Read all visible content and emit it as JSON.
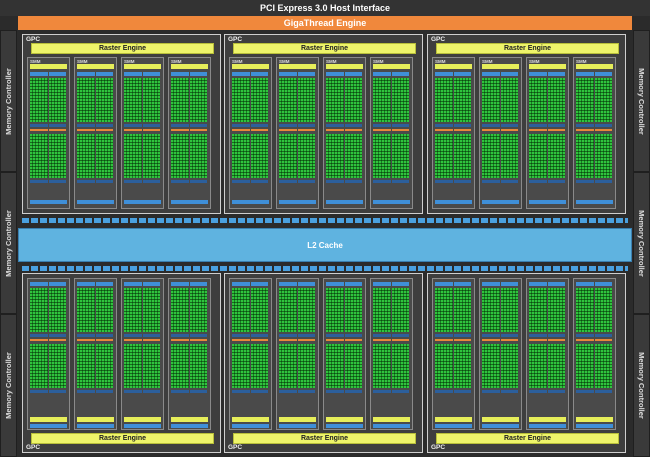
{
  "host_interface": "PCI Express 3.0 Host Interface",
  "gigathread": "GigaThread Engine",
  "memory_controller": "Memory Controller",
  "l2_cache": "L2 Cache",
  "gpc_label": "GPC",
  "raster_engine": "Raster Engine",
  "smm_label": "SMM",
  "colors": {
    "gpc_bg": "#3e3e3e",
    "raster": "#eef46a",
    "core": "#2fc43d",
    "l2": "#5fb3e0",
    "gigathread": "#f0883c"
  }
}
